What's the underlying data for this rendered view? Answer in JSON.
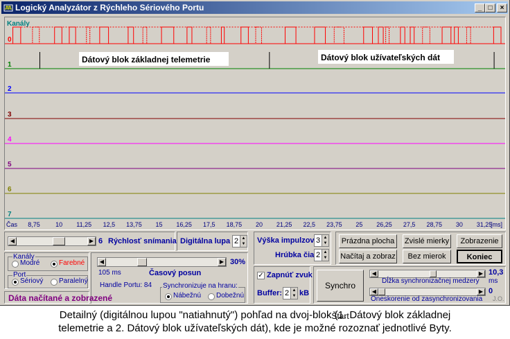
{
  "window": {
    "title": "Logický Analyzátor z Rýchleho Sériového Portu",
    "controls": {
      "minimize": "_",
      "maximize": "□",
      "close": "×"
    }
  },
  "plot": {
    "channels_title": "Kanály",
    "channels": [
      {
        "label": "0",
        "color": "#ff0000"
      },
      {
        "label": "1",
        "color": "#008000"
      },
      {
        "label": "2",
        "color": "#0000ff"
      },
      {
        "label": "3",
        "color": "#800000"
      },
      {
        "label": "4",
        "color": "#ff00ff"
      },
      {
        "label": "5",
        "color": "#800080"
      },
      {
        "label": "6",
        "color": "#808000"
      },
      {
        "label": "7",
        "color": "#008080"
      }
    ],
    "annotation_1": "Dátový blok základnej telemetrie",
    "annotation_2": "Dátový blok užívateľských dát",
    "time_label": "Čas",
    "time_unit": "[ms]",
    "ticks": [
      "8,75",
      "10",
      "11,25",
      "12,5",
      "13,75",
      "15",
      "16,25",
      "17,5",
      "18,75",
      "20",
      "21,25",
      "22,5",
      "23,75",
      "25",
      "26,25",
      "27,5",
      "28,75",
      "30",
      "31,25"
    ],
    "channel0_pulses": [
      [
        0.5,
        2.1
      ],
      [
        4.5,
        5.9
      ],
      [
        9.0,
        10.5
      ],
      [
        12.0,
        13.3
      ],
      [
        15.5,
        16.2
      ],
      [
        18.2,
        20.0
      ],
      [
        24.0,
        25.1
      ],
      [
        27.0,
        27.8
      ],
      [
        30.8,
        33.3
      ],
      [
        36.0,
        37.0
      ],
      [
        40.0,
        40.8
      ],
      [
        43.0,
        43.6
      ],
      [
        47.0,
        48.5
      ],
      [
        50.0,
        51.2
      ],
      [
        56.0,
        58.2
      ],
      [
        62.0,
        64.2
      ],
      [
        66.0,
        68.0
      ],
      [
        72.0,
        73.8
      ],
      [
        75.0,
        76.0
      ],
      [
        76.5,
        77.2
      ],
      [
        79.5,
        80.4
      ],
      [
        81.5,
        82.3
      ],
      [
        84.0,
        85.5
      ],
      [
        88.0,
        89.8
      ],
      [
        90.5,
        91.3
      ],
      [
        93.0,
        93.8
      ],
      [
        98.5,
        100.0
      ]
    ],
    "channel1_markers": [
      6.0,
      52.8,
      98.6
    ]
  },
  "controls": {
    "speed_value": "6",
    "speed_label": "Rýchlosť snímania",
    "zoom_label": "Digitálna lupa",
    "zoom_value": "2",
    "channels_group": "Kanály",
    "mode_mono": "Modré",
    "mode_color": "Farebné",
    "port_group": "Port",
    "port_serial": "Sériový",
    "port_parallel": "Paralelný",
    "shift_ms": "105 ms",
    "shift_label": "Časový posun",
    "shift_percent": "30%",
    "shift_fraction": 0.3,
    "handle_label": "Handle Portu: 84",
    "sync_group": "Synchronizuje na hranu:",
    "sync_rising": "Nábežnú",
    "sync_falling": "Dobežnú",
    "status": "Dáta načítané a zobrazené",
    "pulse_height_label": "Výška impulzov",
    "pulse_height_value": "3",
    "line_width_label": "Hrúbka čiary",
    "line_width_value": "2",
    "sound_label": "Zapnúť zvuk",
    "buffer_label": "Buffer:",
    "buffer_value": "2",
    "buffer_unit": "kB",
    "btn_clear": "Prázdna plocha",
    "btn_vertical": "Zvislé mierky",
    "btn_display": "Zobrazenie",
    "btn_load": "Načítaj a zobraz",
    "btn_no_scale": "Bez mierok",
    "btn_end": "Koniec",
    "btn_sync_start": "Synchro Štart",
    "gap_value": "10,3",
    "gap_unit": "ms",
    "gap_label": "Dĺžka synchronizačnej medzery",
    "gap_fraction": 0.55,
    "delay_value": "0",
    "delay_label": "Oneskorenie od zasynchronizovania",
    "corner_mark": "J.O."
  },
  "caption": {
    "line1": "Detailný (digitálnou lupou \"natiahnutý\") pohľad na dvoj-blok (1. Dátový blok základnej",
    "line2": "telemetrie a 2. Dátový blok užívateľských dát), kde je možné rozoznať jednotlivé Byty."
  }
}
